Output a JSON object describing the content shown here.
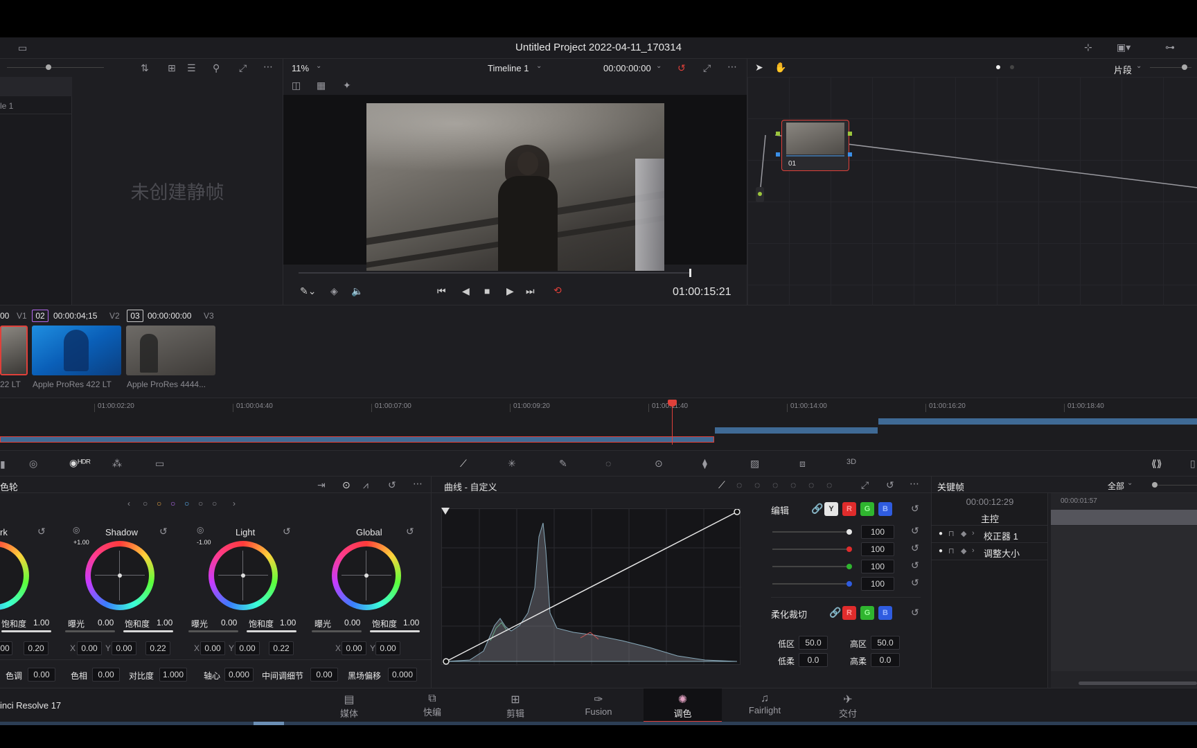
{
  "project_title": "Untitled Project 2022-04-11_170314",
  "viewer": {
    "zoom": "11%",
    "timeline_name": "Timeline 1",
    "timecode_top": "00:00:00:00",
    "timecode_playhead": "01:00:15:21",
    "playhead_progress": 0.995
  },
  "gallery": {
    "album_label": "le 1",
    "empty_text": "未创建静帧"
  },
  "node_editor": {
    "node_label": "01",
    "clip_dropdown": "片段"
  },
  "clips": {
    "clip1": {
      "num": "00",
      "track": "V1",
      "codec": "22 LT"
    },
    "clip2": {
      "num": "02",
      "timecode": "00:00:04;15",
      "track": "V2",
      "codec": "Apple ProRes 422 LT"
    },
    "clip3": {
      "num": "03",
      "timecode": "00:00:00:00",
      "track": "V3",
      "codec": "Apple ProRes 4444..."
    }
  },
  "mini_timeline": {
    "ticks": [
      "01:00:02:20",
      "01:00:04:40",
      "01:00:07:00",
      "01:00:09:20",
      "01:00:11:40",
      "01:00:14:00",
      "01:00:16:20",
      "01:00:18:40"
    ]
  },
  "wheels_panel": {
    "title": "色轮",
    "wheels": [
      {
        "name": "rk",
        "sat_label": "饱和度",
        "sat_value": "1.00",
        "x_value": "00",
        "extra_value": "0.20"
      },
      {
        "name": "Shadow",
        "badge": "+1.00",
        "exp_label": "曝光",
        "exp_value": "0.00",
        "sat_label": "饱和度",
        "sat_value": "1.00",
        "x_label": "X",
        "x_value": "0.00",
        "y_label": "Y",
        "y_value": "0.00",
        "extra_value": "0.22"
      },
      {
        "name": "Light",
        "badge": "-1.00",
        "exp_label": "曝光",
        "exp_value": "0.00",
        "sat_label": "饱和度",
        "sat_value": "1.00",
        "x_label": "X",
        "x_value": "0.00",
        "y_label": "Y",
        "y_value": "0.00",
        "extra_value": "0.22"
      },
      {
        "name": "Global",
        "exp_label": "曝光",
        "exp_value": "0.00",
        "sat_label": "饱和度",
        "sat_value": "1.00",
        "x_label": "X",
        "x_value": "0.00",
        "y_label": "Y",
        "y_value": "0.00"
      }
    ],
    "bottom": [
      {
        "label": "色调",
        "value": "0.00"
      },
      {
        "label": "色相",
        "value": "0.00"
      },
      {
        "label": "对比度",
        "value": "1.000"
      },
      {
        "label": "轴心",
        "value": "0.000"
      },
      {
        "label": "中间调细节",
        "value": "0.00"
      },
      {
        "label": "黑场偏移",
        "value": "0.000"
      }
    ]
  },
  "curves_panel": {
    "title": "曲线 - 自定义",
    "edit_label": "编辑",
    "channels": [
      "Y",
      "R",
      "G",
      "B"
    ],
    "intensity": [
      "100",
      "100",
      "100",
      "100"
    ],
    "soft_clip_label": "柔化裁切",
    "soft_clip_channels": [
      "R",
      "G",
      "B"
    ],
    "low_label": "低区",
    "low_value": "50.0",
    "high_label": "高区",
    "high_value": "50.0",
    "low_soft_label": "低柔",
    "low_soft_value": "0.0",
    "high_soft_label": "高柔",
    "high_soft_value": "0.0"
  },
  "keyframes_panel": {
    "title": "关键帧",
    "filter": "全部",
    "timecode": "00:00:12:29",
    "ruler_time": "00:00:01:57",
    "master": "主控",
    "rows": [
      "校正器 1",
      "调整大小"
    ]
  },
  "app_name": "inci Resolve 17",
  "pages": [
    "媒体",
    "快编",
    "剪辑",
    "Fusion",
    "调色",
    "Fairlight",
    "交付"
  ],
  "active_page": "调色",
  "colors": {
    "accent_red": "#e0403a",
    "panel_bg": "#1e1e22",
    "clip_blue": "#3f6a95"
  }
}
